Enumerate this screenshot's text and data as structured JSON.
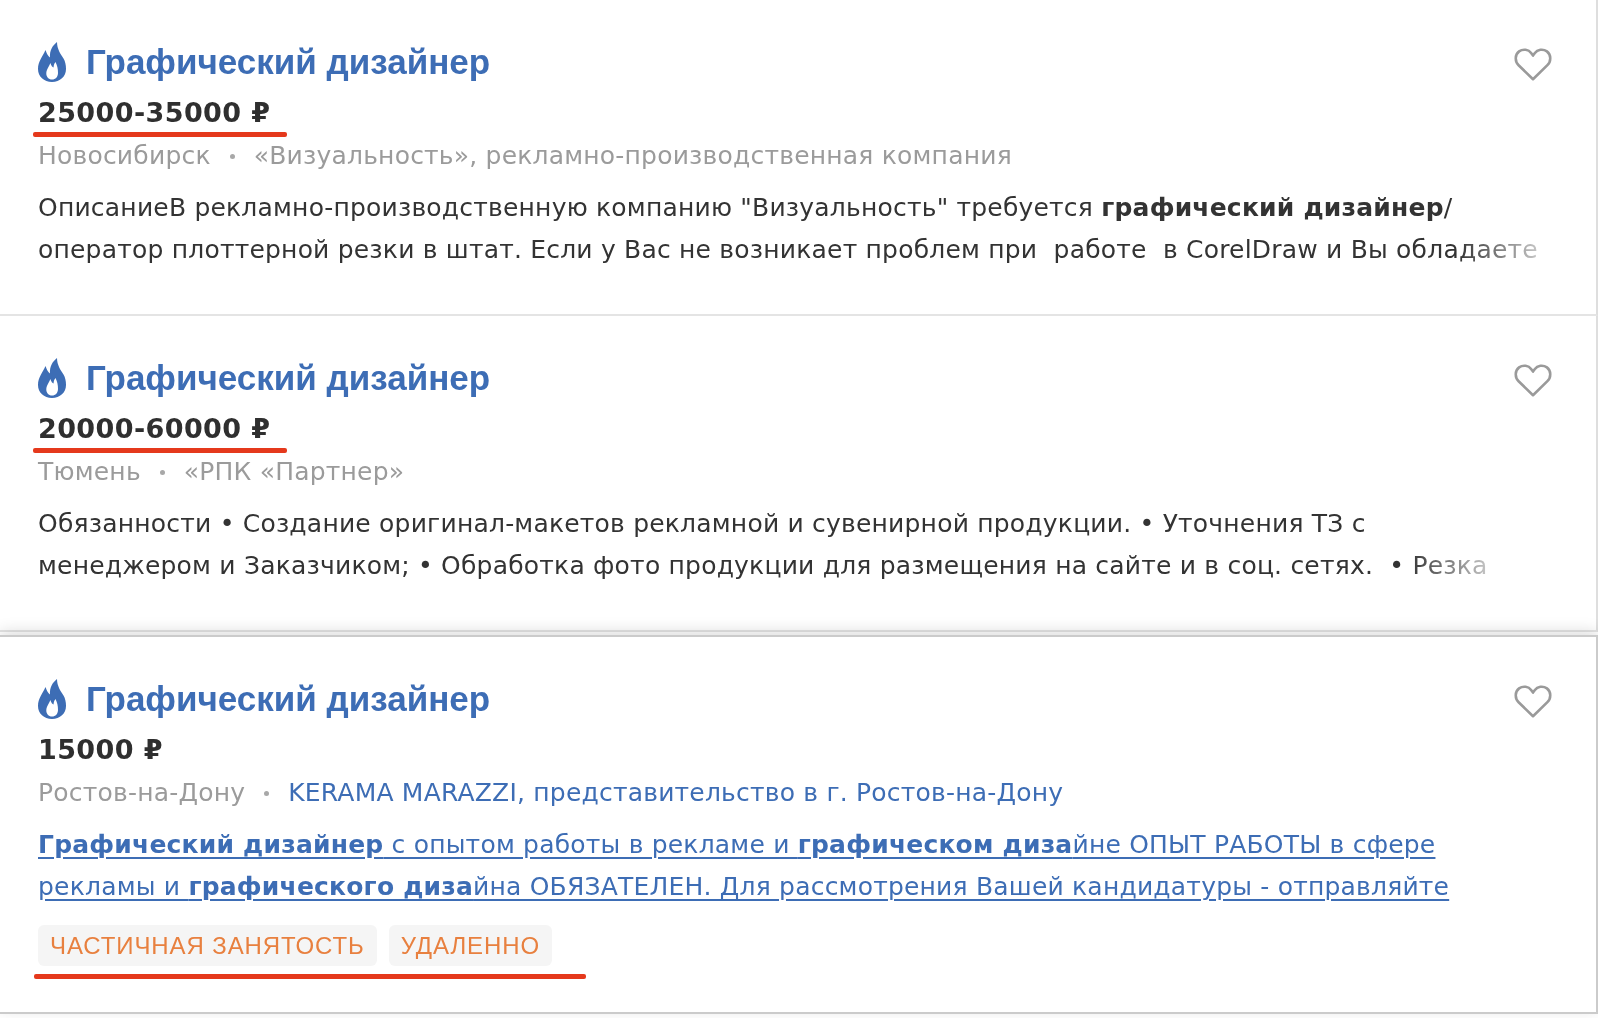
{
  "vacancies": [
    {
      "kind": "regular",
      "hot": true,
      "title": "Графический дизайнер",
      "favorite": false,
      "hovered": false,
      "salary": "25000-35000 ₽",
      "salary_underlined": true,
      "city": "Новосибирск",
      "company": "«Визуальность», рекламно-производственная компания",
      "description": "ОписаниеВ рекламно-производственную компанию \"Визуальность\" требуется **графический дизайнер**/\nоператор плоттерной резки в штат. Если у Вас не возникает проблем при  работе  в CorelDraw и Вы обладаете"
    },
    {
      "kind": "regular",
      "hot": true,
      "title": "Графический дизайнер",
      "favorite": false,
      "hovered": false,
      "salary": "20000-60000 ₽",
      "salary_underlined": true,
      "city": "Тюмень",
      "company": "«РПК «Партнер»",
      "description": "Обязанности • Создание оригинал-макетов рекламной и сувенирной продукции. • Уточнения ТЗ с\nменеджером и Заказчиком; • Обработка фото продукции для размещения на сайте и в соц. сетях.  • Резка"
    },
    {
      "kind": "linked",
      "hot": true,
      "title": "Графический дизайнер",
      "favorite": false,
      "hovered": true,
      "salary": "15000 ₽",
      "salary_underlined": false,
      "city": "Ростов-на-Дону",
      "company": "KERAMA MARAZZI, представительство в г. Ростов-на-Дону",
      "description": "**Графический дизайнер** с опытом работы в рекламе и **графическом диза**йне ОПЫТ РАБОТЫ в сфере\nрекламы и **графического диза**йна ОБЯЗАТЕЛЕН. Для рассмотрения Вашей кандидатуры - отправляйте",
      "tags": [
        "ЧАСТИЧНАЯ ЗАНЯТОСТЬ",
        "УДАЛЕННО"
      ],
      "tags_underlined": true
    }
  ]
}
